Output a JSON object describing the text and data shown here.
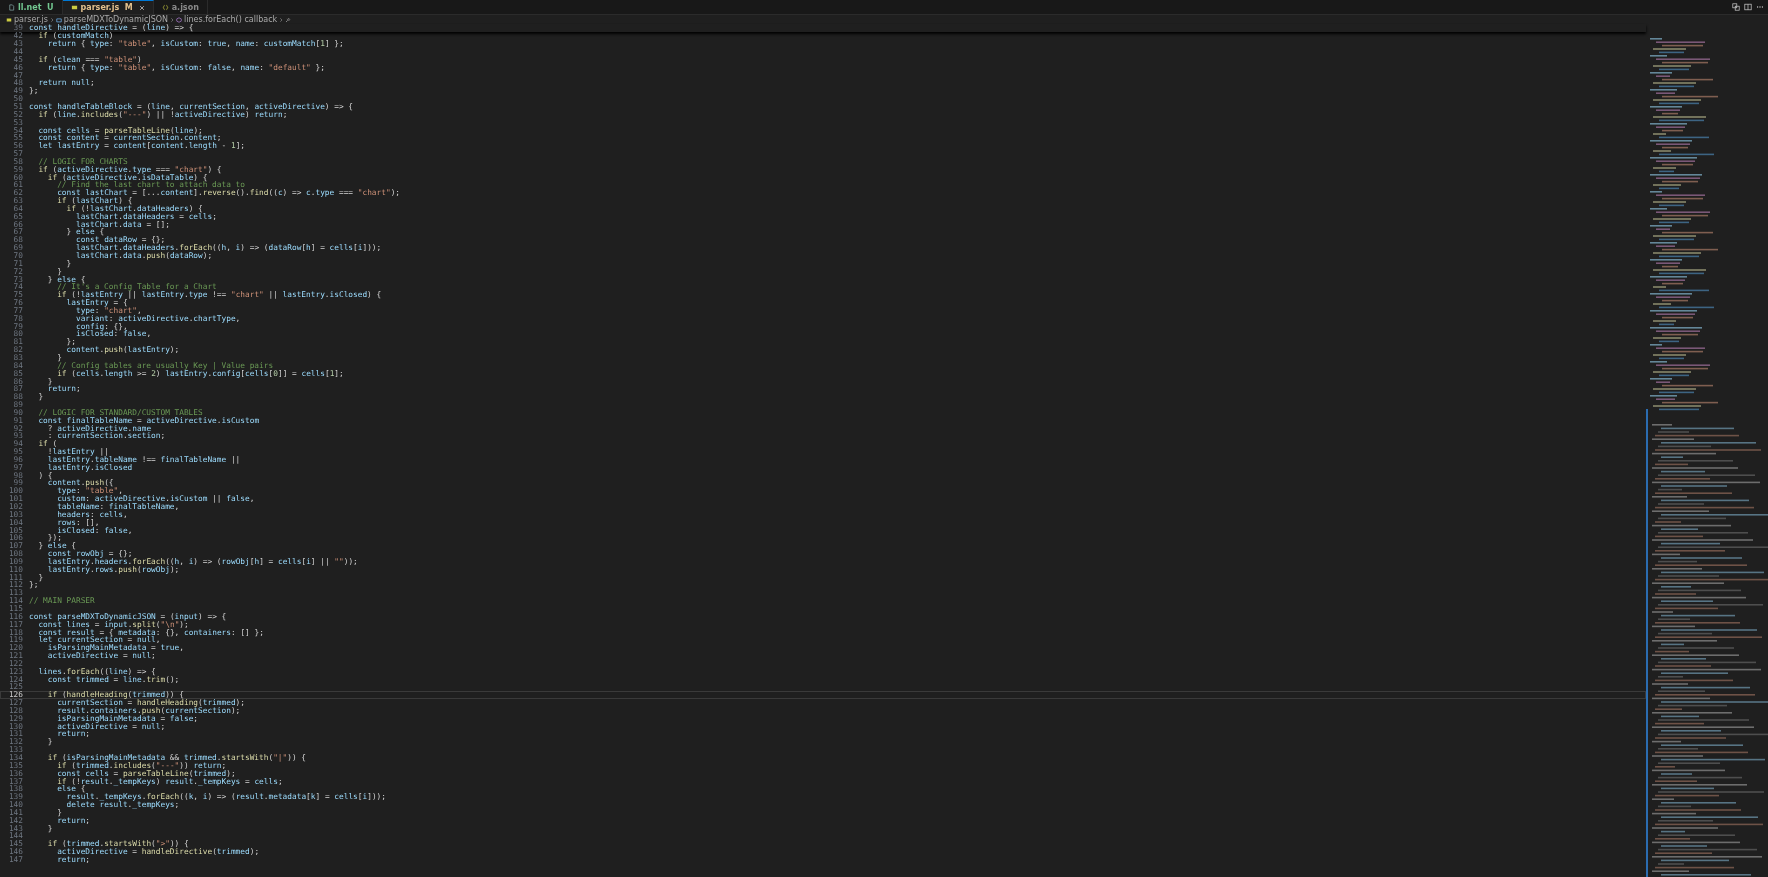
{
  "tabs": [
    {
      "label": "ll.net",
      "badge": "U",
      "kind": "file",
      "color": "#73c991",
      "selected": false,
      "closable": false
    },
    {
      "label": "parser.js",
      "badge": "M",
      "kind": "js",
      "color": "#e2c08d",
      "selected": true,
      "closable": true
    },
    {
      "label": "a.json",
      "kind": "json",
      "color": "#8a8a8a",
      "selected": false,
      "closable": false
    }
  ],
  "breadcrumbs": [
    {
      "label": "parser.js",
      "kind": "js"
    },
    {
      "label": "parseMDXToDynamicJSON",
      "kind": "method"
    },
    {
      "label": "lines.forEach() callback",
      "kind": "function"
    }
  ],
  "sticky_line": {
    "number": "39",
    "text": "const handleDirective = (line) => {"
  },
  "lines": [
    {
      "number": "42",
      "text": "  if (customMatch)",
      "current": false
    },
    {
      "number": "43",
      "text": "    return { type: \"table\", isCustom: true, name: customMatch[1] };",
      "current": false
    },
    {
      "number": "44",
      "current": false
    },
    {
      "number": "45",
      "text": "  if (clean === \"table\")",
      "current": false
    },
    {
      "number": "46",
      "text": "    return { type: \"table\", isCustom: false, name: \"default\" };",
      "current": false
    },
    {
      "number": "47",
      "current": false
    },
    {
      "number": "48",
      "text": "  return null;",
      "current": false
    },
    {
      "number": "49",
      "text": "};",
      "current": false
    },
    {
      "number": "50",
      "current": false
    },
    {
      "number": "51",
      "text": "const handleTableBlock = (line, currentSection, activeDirective) => {",
      "current": false
    },
    {
      "number": "52",
      "text": "  if (line.includes(\"---\") || !activeDirective) return;",
      "current": false
    },
    {
      "number": "53",
      "current": false
    },
    {
      "number": "54",
      "text": "  const cells = parseTableLine(line);",
      "current": false
    },
    {
      "number": "55",
      "text": "  const content = currentSection.content;",
      "current": false
    },
    {
      "number": "56",
      "text": "  let lastEntry = content[content.length - 1];",
      "current": false
    },
    {
      "number": "57",
      "current": false
    },
    {
      "number": "58",
      "text": "  // LOGIC FOR CHARTS",
      "current": false
    },
    {
      "number": "59",
      "text": "  if (activeDirective.type === \"chart\") {",
      "current": false
    },
    {
      "number": "60",
      "text": "    if (activeDirective.isDataTable) {",
      "current": false
    },
    {
      "number": "61",
      "text": "      // Find the last chart to attach data to",
      "current": false
    },
    {
      "number": "62",
      "text": "      const lastChart = [...content].reverse().find((c) => c.type === \"chart\");",
      "current": false
    },
    {
      "number": "63",
      "text": "      if (lastChart) {",
      "current": false
    },
    {
      "number": "64",
      "text": "        if (!lastChart.dataHeaders) {",
      "current": false
    },
    {
      "number": "65",
      "text": "          lastChart.dataHeaders = cells;",
      "current": false
    },
    {
      "number": "66",
      "text": "          lastChart.data = [];",
      "current": false
    },
    {
      "number": "67",
      "text": "        } else {",
      "current": false
    },
    {
      "number": "68",
      "text": "          const dataRow = {};",
      "current": false
    },
    {
      "number": "69",
      "text": "          lastChart.dataHeaders.forEach((h, i) => (dataRow[h] = cells[i]));",
      "current": false
    },
    {
      "number": "70",
      "text": "          lastChart.data.push(dataRow);",
      "current": false
    },
    {
      "number": "71",
      "text": "        }",
      "current": false
    },
    {
      "number": "72",
      "text": "      }",
      "current": false
    },
    {
      "number": "73",
      "text": "    } else {",
      "current": false
    },
    {
      "number": "74",
      "text": "      // It's a Config Table for a Chart",
      "current": false
    },
    {
      "number": "75",
      "text": "      if (!lastEntry || lastEntry.type !== \"chart\" || lastEntry.isClosed) {",
      "current": false
    },
    {
      "number": "76",
      "text": "        lastEntry = {",
      "current": false
    },
    {
      "number": "77",
      "text": "          type: \"chart\",",
      "current": false
    },
    {
      "number": "78",
      "text": "          variant: activeDirective.chartType,",
      "current": false
    },
    {
      "number": "79",
      "text": "          config: {},",
      "current": false
    },
    {
      "number": "80",
      "text": "          isClosed: false,",
      "current": false
    },
    {
      "number": "81",
      "text": "        };",
      "current": false
    },
    {
      "number": "82",
      "text": "        content.push(lastEntry);",
      "current": false
    },
    {
      "number": "83",
      "text": "      }",
      "current": false
    },
    {
      "number": "84",
      "text": "      // Config tables are usually Key | Value pairs",
      "current": false
    },
    {
      "number": "85",
      "text": "      if (cells.length >= 2) lastEntry.config[cells[0]] = cells[1];",
      "current": false
    },
    {
      "number": "86",
      "text": "    }",
      "current": false
    },
    {
      "number": "87",
      "text": "    return;",
      "current": false
    },
    {
      "number": "88",
      "text": "  }",
      "current": false
    },
    {
      "number": "89",
      "current": false
    },
    {
      "number": "90",
      "text": "  // LOGIC FOR STANDARD/CUSTOM TABLES",
      "current": false
    },
    {
      "number": "91",
      "text": "  const finalTableName = activeDirective.isCustom",
      "current": false
    },
    {
      "number": "92",
      "text": "    ? activeDirective.name",
      "current": false
    },
    {
      "number": "93",
      "text": "    : currentSection.section;",
      "current": false
    },
    {
      "number": "94",
      "text": "  if (",
      "current": false
    },
    {
      "number": "95",
      "text": "    !lastEntry ||",
      "current": false
    },
    {
      "number": "96",
      "text": "    lastEntry.tableName !== finalTableName ||",
      "current": false
    },
    {
      "number": "97",
      "text": "    lastEntry.isClosed",
      "current": false
    },
    {
      "number": "98",
      "text": "  ) {",
      "current": false
    },
    {
      "number": "99",
      "text": "    content.push({",
      "current": false
    },
    {
      "number": "100",
      "text": "      type: \"table\",",
      "current": false
    },
    {
      "number": "101",
      "text": "      custom: activeDirective.isCustom || false,",
      "current": false
    },
    {
      "number": "102",
      "text": "      tableName: finalTableName,",
      "current": false
    },
    {
      "number": "103",
      "text": "      headers: cells,",
      "current": false
    },
    {
      "number": "104",
      "text": "      rows: [],",
      "current": false
    },
    {
      "number": "105",
      "text": "      isClosed: false,",
      "current": false
    },
    {
      "number": "106",
      "text": "    });",
      "current": false
    },
    {
      "number": "107",
      "text": "  } else {",
      "current": false
    },
    {
      "number": "108",
      "text": "    const rowObj = {};",
      "current": false
    },
    {
      "number": "109",
      "text": "    lastEntry.headers.forEach((h, i) => (rowObj[h] = cells[i] || \"\"));",
      "current": false
    },
    {
      "number": "110",
      "text": "    lastEntry.rows.push(rowObj);",
      "current": false
    },
    {
      "number": "111",
      "text": "  }",
      "current": false
    },
    {
      "number": "112",
      "text": "};",
      "current": false
    },
    {
      "number": "113",
      "current": false
    },
    {
      "number": "114",
      "text": "// MAIN PARSER",
      "current": false
    },
    {
      "number": "115",
      "current": false
    },
    {
      "number": "116",
      "text": "const parseMDXToDynamicJSON = (input) => {",
      "current": false
    },
    {
      "number": "117",
      "text": "  const lines = input.split(\"\\n\");",
      "current": false
    },
    {
      "number": "118",
      "text": "  const result = { metadata: {}, containers: [] };",
      "current": false
    },
    {
      "number": "119",
      "text": "  let currentSection = null,",
      "current": false
    },
    {
      "number": "120",
      "text": "    isParsingMainMetadata = true,",
      "current": false
    },
    {
      "number": "121",
      "text": "    activeDirective = null;",
      "current": false
    },
    {
      "number": "122",
      "current": false
    },
    {
      "number": "123",
      "text": "  lines.forEach((line) => {",
      "current": false
    },
    {
      "number": "124",
      "text": "    const trimmed = line.trim();",
      "current": false
    },
    {
      "number": "125",
      "current": false
    },
    {
      "number": "126",
      "text": "    if (handleHeading(trimmed)) {",
      "current": true
    },
    {
      "number": "127",
      "text": "      currentSection = handleHeading(trimmed);",
      "current": false
    },
    {
      "number": "128",
      "text": "      result.containers.push(currentSection);",
      "current": false
    },
    {
      "number": "129",
      "text": "      isParsingMainMetadata = false;",
      "current": false
    },
    {
      "number": "130",
      "text": "      activeDirective = null;",
      "current": false
    },
    {
      "number": "131",
      "text": "      return;",
      "current": false
    },
    {
      "number": "132",
      "text": "    }",
      "current": false
    },
    {
      "number": "133",
      "current": false
    },
    {
      "number": "134",
      "text": "    if (isParsingMainMetadata && trimmed.startsWith(\"|\")) {",
      "current": false
    },
    {
      "number": "135",
      "text": "      if (trimmed.includes(\"---\")) return;",
      "current": false
    },
    {
      "number": "136",
      "text": "      const cells = parseTableLine(trimmed);",
      "current": false
    },
    {
      "number": "137",
      "text": "      if (!result._tempKeys) result._tempKeys = cells;",
      "current": false
    },
    {
      "number": "138",
      "text": "      else {",
      "current": false
    },
    {
      "number": "139",
      "text": "        result._tempKeys.forEach((k, i) => (result.metadata[k] = cells[i]));",
      "current": false
    },
    {
      "number": "140",
      "text": "        delete result._tempKeys;",
      "current": false
    },
    {
      "number": "141",
      "text": "      }",
      "current": false
    },
    {
      "number": "142",
      "text": "      return;",
      "current": false
    },
    {
      "number": "143",
      "text": "    }",
      "current": false
    },
    {
      "number": "144",
      "current": false
    },
    {
      "number": "145",
      "text": "    if (trimmed.startsWith(\">\")) {",
      "current": false
    },
    {
      "number": "146",
      "text": "      activeDirective = handleDirective(trimmed);",
      "current": false
    },
    {
      "number": "147",
      "text": "      return;",
      "current": false
    }
  ]
}
